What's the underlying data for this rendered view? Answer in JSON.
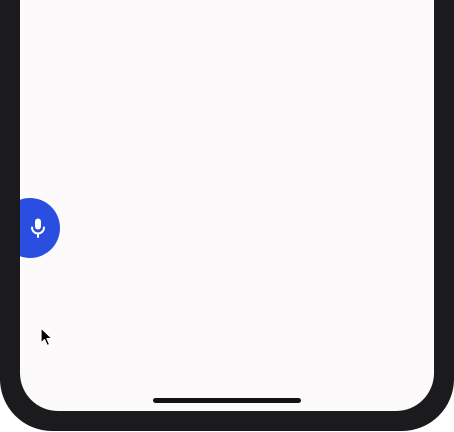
{
  "screen": {
    "background": "#fdfafc"
  },
  "voice_button": {
    "icon": "microphone-icon",
    "color": "#2a4fe0"
  },
  "home_indicator": {
    "color": "#141414"
  },
  "cursor": {
    "icon": "mouse-pointer-icon"
  }
}
